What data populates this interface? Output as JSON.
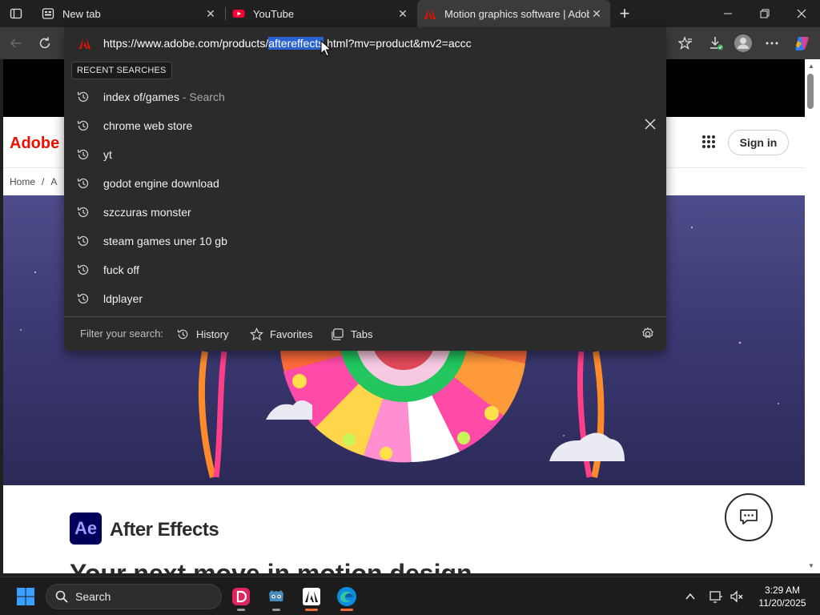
{
  "browser": {
    "tabs": [
      {
        "title": "New tab",
        "active": false,
        "icon": "new-tab-icon"
      },
      {
        "title": "YouTube",
        "active": false,
        "icon": "youtube-icon"
      },
      {
        "title": "Motion graphics software | Adobe",
        "active": true,
        "icon": "adobe-icon"
      }
    ],
    "omnibox": {
      "url_prefix": "https://www.adobe.com/products/",
      "url_selected": "aftereffects",
      "url_suffix": ".html?mv=product&mv2=accc"
    },
    "dropdown": {
      "recent_label": "RECENT SEARCHES",
      "suggestions": [
        {
          "text": "index of/games",
          "suffix": " - Search"
        },
        {
          "text": "chrome web store",
          "suffix": ""
        },
        {
          "text": "yt",
          "suffix": ""
        },
        {
          "text": "godot engine download",
          "suffix": ""
        },
        {
          "text": "szczuras monster",
          "suffix": ""
        },
        {
          "text": "steam games uner 10 gb",
          "suffix": ""
        },
        {
          "text": "fuck off",
          "suffix": ""
        },
        {
          "text": "ldplayer",
          "suffix": ""
        }
      ],
      "filter_label": "Filter your search:",
      "filters": [
        "History",
        "Favorites",
        "Tabs"
      ]
    }
  },
  "page": {
    "logo": "Adobe",
    "sign_in": "Sign in",
    "breadcrumb": [
      "Home",
      "/",
      "A"
    ],
    "product_badge": "Ae",
    "product_name": "After Effects",
    "headline": "Your next move in motion design"
  },
  "taskbar": {
    "search_label": "Search",
    "time": "3:29 AM",
    "date": "11/20/2025"
  },
  "colors": {
    "adobe_red": "#eb1000",
    "selection_blue": "#2a63cf",
    "hero_top": "#4e4c8a",
    "hero_bottom": "#2b2a57"
  }
}
